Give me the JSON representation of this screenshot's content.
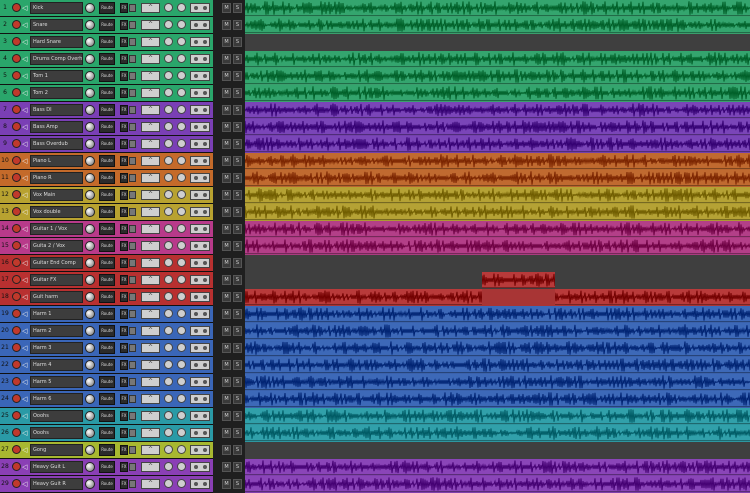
{
  "tcp_labels": {
    "route": "Route",
    "fx": "FX",
    "mute": "M",
    "solo": "S"
  },
  "tracks": [
    {
      "num": "1",
      "name": "Kick",
      "color": "#2aa66b",
      "lane": "#3a9f6d",
      "item": "#34a56e"
    },
    {
      "num": "2",
      "name": "Snare",
      "color": "#2aa66b",
      "lane": "#3a9f6d",
      "item": "#34a56e"
    },
    {
      "num": "3",
      "name": "Hard Snare",
      "color": "#2aa66b",
      "lane": "#3f3f3f",
      "item": ""
    },
    {
      "num": "4",
      "name": "Drums Comp Overh",
      "color": "#2aa66b",
      "lane": "#3a9f6d",
      "item": "#34a56e"
    },
    {
      "num": "5",
      "name": "Tom 1",
      "color": "#2aa66b",
      "lane": "#3a9f6d",
      "item": "#34a56e"
    },
    {
      "num": "6",
      "name": "Tom 2",
      "color": "#2aa66b",
      "lane": "#3a9f6d",
      "item": "#34a56e"
    },
    {
      "num": "7",
      "name": "Bass DI",
      "color": "#7a3fb5",
      "lane": "#7340ad",
      "item": "#7a45b8"
    },
    {
      "num": "8",
      "name": "Bass Amp",
      "color": "#7a3fb5",
      "lane": "#7340ad",
      "item": "#7a45b8"
    },
    {
      "num": "9",
      "name": "Bass Overdub",
      "color": "#7a3fb5",
      "lane": "#7340ad",
      "item": "#7a45b8"
    },
    {
      "num": "10",
      "name": "Piano L",
      "color": "#c46a2a",
      "lane": "#b8652e",
      "item": "#c06a30"
    },
    {
      "num": "11",
      "name": "Piano R",
      "color": "#c46a2a",
      "lane": "#b8652e",
      "item": "#c06a30"
    },
    {
      "num": "12",
      "name": "Vox Main",
      "color": "#b8a230",
      "lane": "#ab9a30",
      "item": "#b5a235"
    },
    {
      "num": "13",
      "name": "Vox double",
      "color": "#b8a230",
      "lane": "#ab9a30",
      "item": "#b5a235"
    },
    {
      "num": "14",
      "name": "Guitar 1 / Vox",
      "color": "#b83a8a",
      "lane": "#aa3b80",
      "item": "#b33f88"
    },
    {
      "num": "15",
      "name": "Guita 2 / Vox",
      "color": "#b83a8a",
      "lane": "#aa3b80",
      "item": "#b33f88"
    },
    {
      "num": "16",
      "name": "Guitar End Comp",
      "color": "#b83030",
      "lane": "#3f3f3f",
      "item": ""
    },
    {
      "num": "17",
      "name": "Guitar FX",
      "color": "#b83030",
      "lane": "#3f3f3f",
      "item": "#b83a3a"
    },
    {
      "num": "18",
      "name": "Guit harm",
      "color": "#b83030",
      "lane": "#a83535",
      "item": "#b83a3a"
    },
    {
      "num": "19",
      "name": "Harm 1",
      "color": "#3a66b8",
      "lane": "#3a62ad",
      "item": "#3d69b8"
    },
    {
      "num": "20",
      "name": "Harm 2",
      "color": "#3a66b8",
      "lane": "#3a62ad",
      "item": "#3d69b8"
    },
    {
      "num": "21",
      "name": "Harm 3",
      "color": "#3a66b8",
      "lane": "#3a62ad",
      "item": "#3d69b8"
    },
    {
      "num": "22",
      "name": "Harm 4",
      "color": "#3a66b8",
      "lane": "#3a62ad",
      "item": "#3d69b8"
    },
    {
      "num": "23",
      "name": "Harm 5",
      "color": "#3a66b8",
      "lane": "#3a62ad",
      "item": "#3d69b8"
    },
    {
      "num": "24",
      "name": "Harm 6",
      "color": "#3a66b8",
      "lane": "#3a62ad",
      "item": "#3d69b8"
    },
    {
      "num": "25",
      "name": "Ooohs",
      "color": "#2a9aa6",
      "lane": "#2d96a0",
      "item": "#31a0aa"
    },
    {
      "num": "26",
      "name": "Ooohs",
      "color": "#2a9aa6",
      "lane": "#2d96a0",
      "item": "#31a0aa"
    },
    {
      "num": "27",
      "name": "Gong",
      "color": "#a8b830",
      "lane": "#3f3f3f",
      "item": ""
    },
    {
      "num": "28",
      "name": "Heavy Guit L",
      "color": "#8a3fb5",
      "lane": "#8040ad",
      "item": "#8a45b8"
    },
    {
      "num": "29",
      "name": "Heavy Guit R",
      "color": "#8a3fb5",
      "lane": "#8040ad",
      "item": "#8a45b8"
    }
  ],
  "colors": {
    "background": "#2a2a2a",
    "arrange_bg": "#3a3a3a",
    "edit_cursor": "#5ad0cc",
    "record_arm": "#c0392b"
  }
}
